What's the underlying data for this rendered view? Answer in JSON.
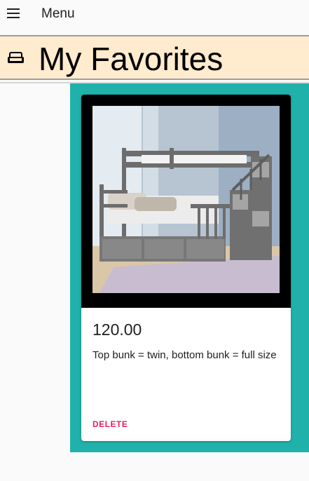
{
  "topbar": {
    "menu_icon": "hamburger-icon",
    "menu_label": "Menu"
  },
  "header": {
    "icon": "sofa-icon",
    "title": "My Favorites",
    "background": "#ffebcd"
  },
  "favorites": {
    "panel_color": "#20b2aa",
    "items": [
      {
        "image_alt": "gray bunk bed with stairs",
        "price": "120.00",
        "description": "Top bunk = twin, bottom bunk = full size",
        "delete_label": "DELETE",
        "delete_color": "#e91e63"
      }
    ]
  }
}
